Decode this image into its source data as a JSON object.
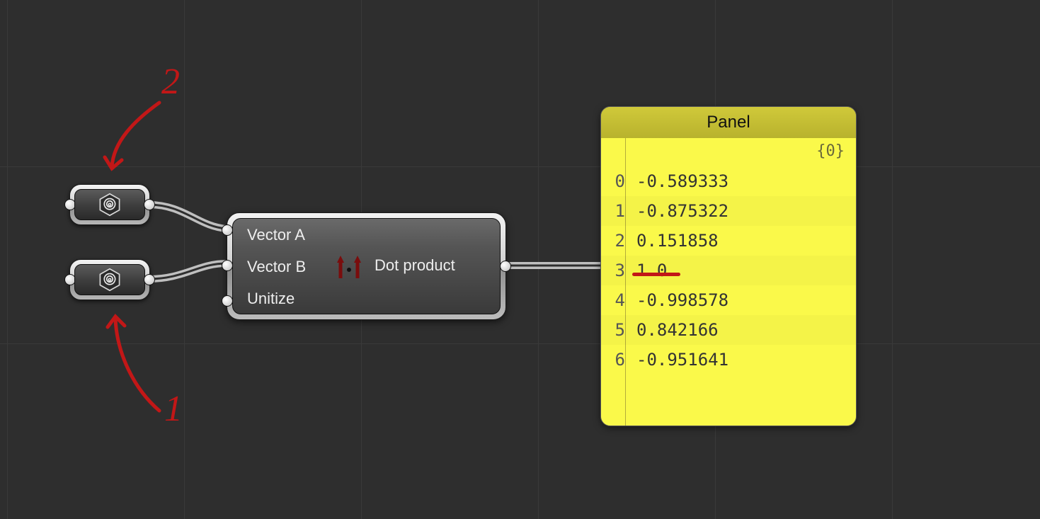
{
  "annotations": {
    "top": "2",
    "bottom": "1"
  },
  "paramA": {
    "icon": "spiral-hex-icon"
  },
  "paramB": {
    "icon": "spiral-hex-icon"
  },
  "component": {
    "inputs": {
      "a": "Vector A",
      "b": "Vector B",
      "u": "Unitize"
    },
    "output": "Dot product",
    "icon": "dot-product-icon"
  },
  "panel": {
    "title": "Panel",
    "path": "{0}",
    "rows": [
      {
        "i": "0",
        "v": "-0.589333"
      },
      {
        "i": "1",
        "v": "-0.875322"
      },
      {
        "i": "2",
        "v": "0.151858"
      },
      {
        "i": "3",
        "v": "1.0"
      },
      {
        "i": "4",
        "v": "-0.998578"
      },
      {
        "i": "5",
        "v": "0.842166"
      },
      {
        "i": "6",
        "v": "-0.951641"
      }
    ],
    "highlight_index": 3
  }
}
